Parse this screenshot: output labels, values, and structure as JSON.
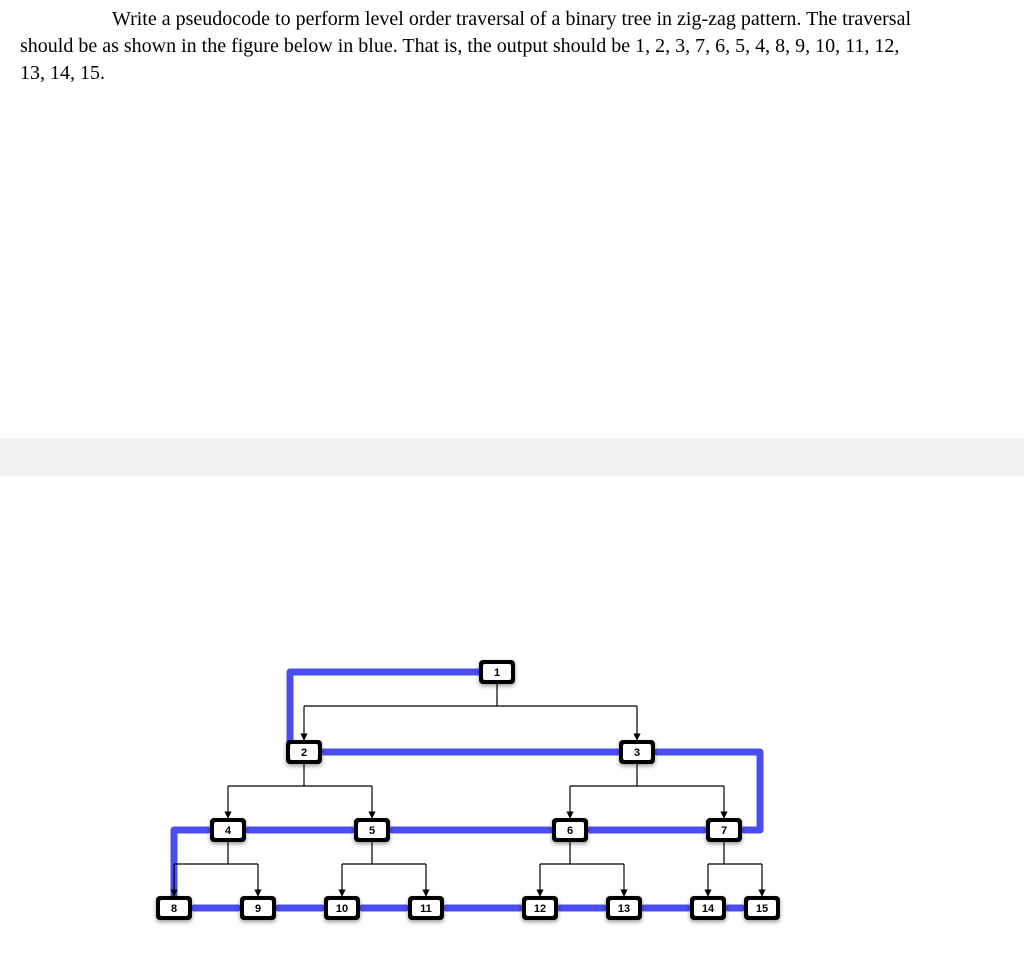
{
  "question": {
    "line1_part1": "Write a pseudocode to perform level order traversal of a binary tree in zig-zag pattern. The traversal",
    "line2": "should be as shown in the figure below in blue.  That is, the output should be 1, 2, 3, 7, 6, 5, 4, 8, 9, 10, 11, 12,",
    "line3": "13, 14, 15."
  },
  "tree": {
    "node1": "1",
    "node2": "2",
    "node3": "3",
    "node4": "4",
    "node5": "5",
    "node6": "6",
    "node7": "7",
    "node8": "8",
    "node9": "9",
    "node10": "10",
    "node11": "11",
    "node12": "12",
    "node13": "13",
    "node14": "14",
    "node15": "15"
  }
}
